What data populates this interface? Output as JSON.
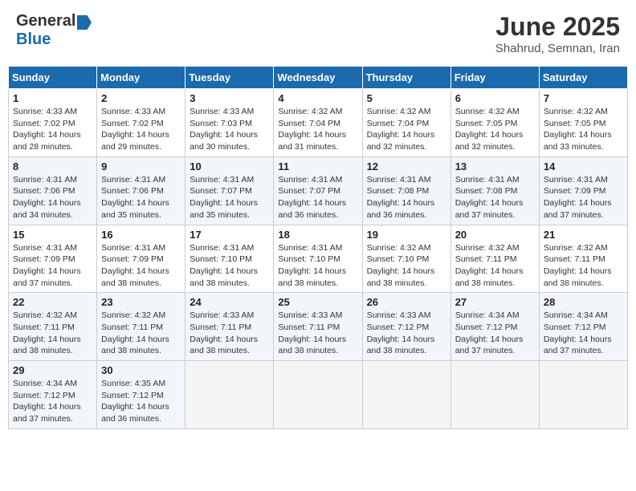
{
  "header": {
    "logo_general": "General",
    "logo_blue": "Blue",
    "month_title": "June 2025",
    "subtitle": "Shahrud, Semnan, Iran"
  },
  "days_of_week": [
    "Sunday",
    "Monday",
    "Tuesday",
    "Wednesday",
    "Thursday",
    "Friday",
    "Saturday"
  ],
  "weeks": [
    [
      {
        "day": 1,
        "sunrise": "4:33 AM",
        "sunset": "7:02 PM",
        "daylight": "14 hours and 28 minutes."
      },
      {
        "day": 2,
        "sunrise": "4:33 AM",
        "sunset": "7:02 PM",
        "daylight": "14 hours and 29 minutes."
      },
      {
        "day": 3,
        "sunrise": "4:33 AM",
        "sunset": "7:03 PM",
        "daylight": "14 hours and 30 minutes."
      },
      {
        "day": 4,
        "sunrise": "4:32 AM",
        "sunset": "7:04 PM",
        "daylight": "14 hours and 31 minutes."
      },
      {
        "day": 5,
        "sunrise": "4:32 AM",
        "sunset": "7:04 PM",
        "daylight": "14 hours and 32 minutes."
      },
      {
        "day": 6,
        "sunrise": "4:32 AM",
        "sunset": "7:05 PM",
        "daylight": "14 hours and 32 minutes."
      },
      {
        "day": 7,
        "sunrise": "4:32 AM",
        "sunset": "7:05 PM",
        "daylight": "14 hours and 33 minutes."
      }
    ],
    [
      {
        "day": 8,
        "sunrise": "4:31 AM",
        "sunset": "7:06 PM",
        "daylight": "14 hours and 34 minutes."
      },
      {
        "day": 9,
        "sunrise": "4:31 AM",
        "sunset": "7:06 PM",
        "daylight": "14 hours and 35 minutes."
      },
      {
        "day": 10,
        "sunrise": "4:31 AM",
        "sunset": "7:07 PM",
        "daylight": "14 hours and 35 minutes."
      },
      {
        "day": 11,
        "sunrise": "4:31 AM",
        "sunset": "7:07 PM",
        "daylight": "14 hours and 36 minutes."
      },
      {
        "day": 12,
        "sunrise": "4:31 AM",
        "sunset": "7:08 PM",
        "daylight": "14 hours and 36 minutes."
      },
      {
        "day": 13,
        "sunrise": "4:31 AM",
        "sunset": "7:08 PM",
        "daylight": "14 hours and 37 minutes."
      },
      {
        "day": 14,
        "sunrise": "4:31 AM",
        "sunset": "7:09 PM",
        "daylight": "14 hours and 37 minutes."
      }
    ],
    [
      {
        "day": 15,
        "sunrise": "4:31 AM",
        "sunset": "7:09 PM",
        "daylight": "14 hours and 37 minutes."
      },
      {
        "day": 16,
        "sunrise": "4:31 AM",
        "sunset": "7:09 PM",
        "daylight": "14 hours and 38 minutes."
      },
      {
        "day": 17,
        "sunrise": "4:31 AM",
        "sunset": "7:10 PM",
        "daylight": "14 hours and 38 minutes."
      },
      {
        "day": 18,
        "sunrise": "4:31 AM",
        "sunset": "7:10 PM",
        "daylight": "14 hours and 38 minutes."
      },
      {
        "day": 19,
        "sunrise": "4:32 AM",
        "sunset": "7:10 PM",
        "daylight": "14 hours and 38 minutes."
      },
      {
        "day": 20,
        "sunrise": "4:32 AM",
        "sunset": "7:11 PM",
        "daylight": "14 hours and 38 minutes."
      },
      {
        "day": 21,
        "sunrise": "4:32 AM",
        "sunset": "7:11 PM",
        "daylight": "14 hours and 38 minutes."
      }
    ],
    [
      {
        "day": 22,
        "sunrise": "4:32 AM",
        "sunset": "7:11 PM",
        "daylight": "14 hours and 38 minutes."
      },
      {
        "day": 23,
        "sunrise": "4:32 AM",
        "sunset": "7:11 PM",
        "daylight": "14 hours and 38 minutes."
      },
      {
        "day": 24,
        "sunrise": "4:33 AM",
        "sunset": "7:11 PM",
        "daylight": "14 hours and 38 minutes."
      },
      {
        "day": 25,
        "sunrise": "4:33 AM",
        "sunset": "7:11 PM",
        "daylight": "14 hours and 38 minutes."
      },
      {
        "day": 26,
        "sunrise": "4:33 AM",
        "sunset": "7:12 PM",
        "daylight": "14 hours and 38 minutes."
      },
      {
        "day": 27,
        "sunrise": "4:34 AM",
        "sunset": "7:12 PM",
        "daylight": "14 hours and 37 minutes."
      },
      {
        "day": 28,
        "sunrise": "4:34 AM",
        "sunset": "7:12 PM",
        "daylight": "14 hours and 37 minutes."
      }
    ],
    [
      {
        "day": 29,
        "sunrise": "4:34 AM",
        "sunset": "7:12 PM",
        "daylight": "14 hours and 37 minutes."
      },
      {
        "day": 30,
        "sunrise": "4:35 AM",
        "sunset": "7:12 PM",
        "daylight": "14 hours and 36 minutes."
      },
      null,
      null,
      null,
      null,
      null
    ]
  ]
}
